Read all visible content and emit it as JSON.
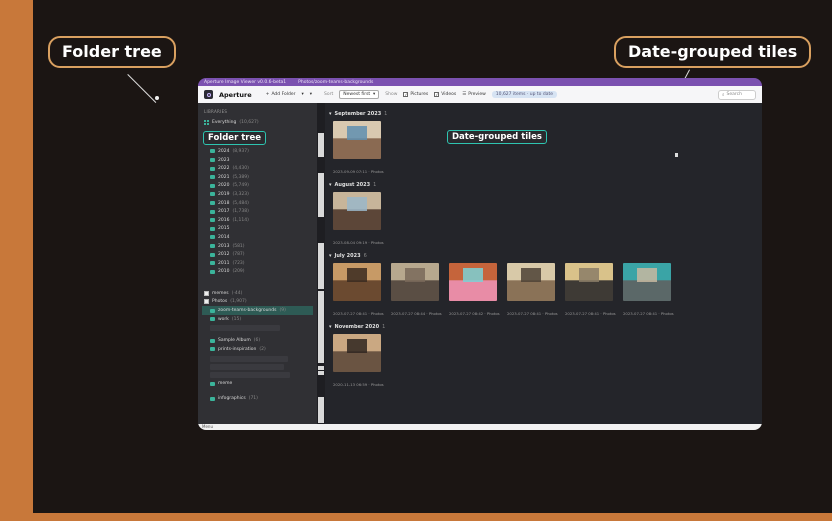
{
  "callouts": {
    "folder_tree": "Folder tree",
    "date_tiles": "Date-grouped tiles"
  },
  "window": {
    "title": "Aperture Image Viewer v0.0.6-beta1",
    "path": "Photos/zoom-teams-backgrounds"
  },
  "toolbar": {
    "app_name": "Aperture",
    "add_folder": "Add Folder",
    "sort_label": "Sort",
    "sort_value": "Newest first",
    "show_label": "Show",
    "pictures": "Pictures",
    "videos": "Videos",
    "preview": "Preview",
    "status": "10,627 items · up to date",
    "search_placeholder": "Search"
  },
  "sidebar": {
    "section": "LIBRARIES",
    "everything": {
      "label": "Everything",
      "count": "(10,627)"
    },
    "embedded_label": "Folder tree",
    "years": [
      {
        "label": "2025",
        "count": "(7,093)"
      },
      {
        "label": "2024",
        "count": "(8,937)"
      },
      {
        "label": "2023",
        "count": ""
      },
      {
        "label": "2022",
        "count": "(4,430)"
      },
      {
        "label": "2021",
        "count": "(5,389)"
      },
      {
        "label": "2020",
        "count": "(5,749)"
      },
      {
        "label": "2019",
        "count": "(3,323)"
      },
      {
        "label": "2018",
        "count": "(5,484)"
      },
      {
        "label": "2017",
        "count": "(1,738)"
      },
      {
        "label": "2016",
        "count": "(1,114)"
      },
      {
        "label": "2015",
        "count": ""
      },
      {
        "label": "2014",
        "count": ""
      },
      {
        "label": "2013",
        "count": "(581)"
      },
      {
        "label": "2012",
        "count": "(787)"
      },
      {
        "label": "2011",
        "count": "(723)"
      },
      {
        "label": "2010",
        "count": "(209)"
      }
    ],
    "memes": {
      "label": "memes",
      "count": "(·44)"
    },
    "photos": {
      "label": "Photos",
      "count": "(1,907)"
    },
    "zoom": {
      "label": "zoom-teams-backgrounds",
      "count": "(9)"
    },
    "work": {
      "label": "work",
      "count": "(15)"
    },
    "sample_album": {
      "label": "Sample Album",
      "count": "(6)"
    },
    "prints": {
      "label": "prints-inspiration",
      "count": "(2)"
    },
    "meme": {
      "label": "meme",
      "count": ""
    },
    "infographics": {
      "label": "infographics",
      "count": "(71)"
    }
  },
  "main": {
    "embedded_label": "Date-grouped tiles",
    "groups": [
      {
        "title": "September 2023",
        "count": "1",
        "captions": [
          "2023-09-09 07:11 · Photos"
        ]
      },
      {
        "title": "August 2023",
        "count": "1",
        "captions": [
          "2023-08-04 09:19 · Photos"
        ]
      },
      {
        "title": "July 2023",
        "count": "6",
        "captions": [
          "2023-07-27 08:41 · Photos",
          "2023-07-27 08:44 · Photos",
          "2023-07-27 08:42 · Photos",
          "2023-07-27 08:41 · Photos",
          "2023-07-27 08:41 · Photos",
          "2023-07-27 08:41 · Photos"
        ]
      },
      {
        "title": "November 2020",
        "count": "1",
        "captions": [
          "2020-11-13 06:59 · Photos"
        ]
      }
    ]
  },
  "footer": {
    "text": "Menu"
  }
}
